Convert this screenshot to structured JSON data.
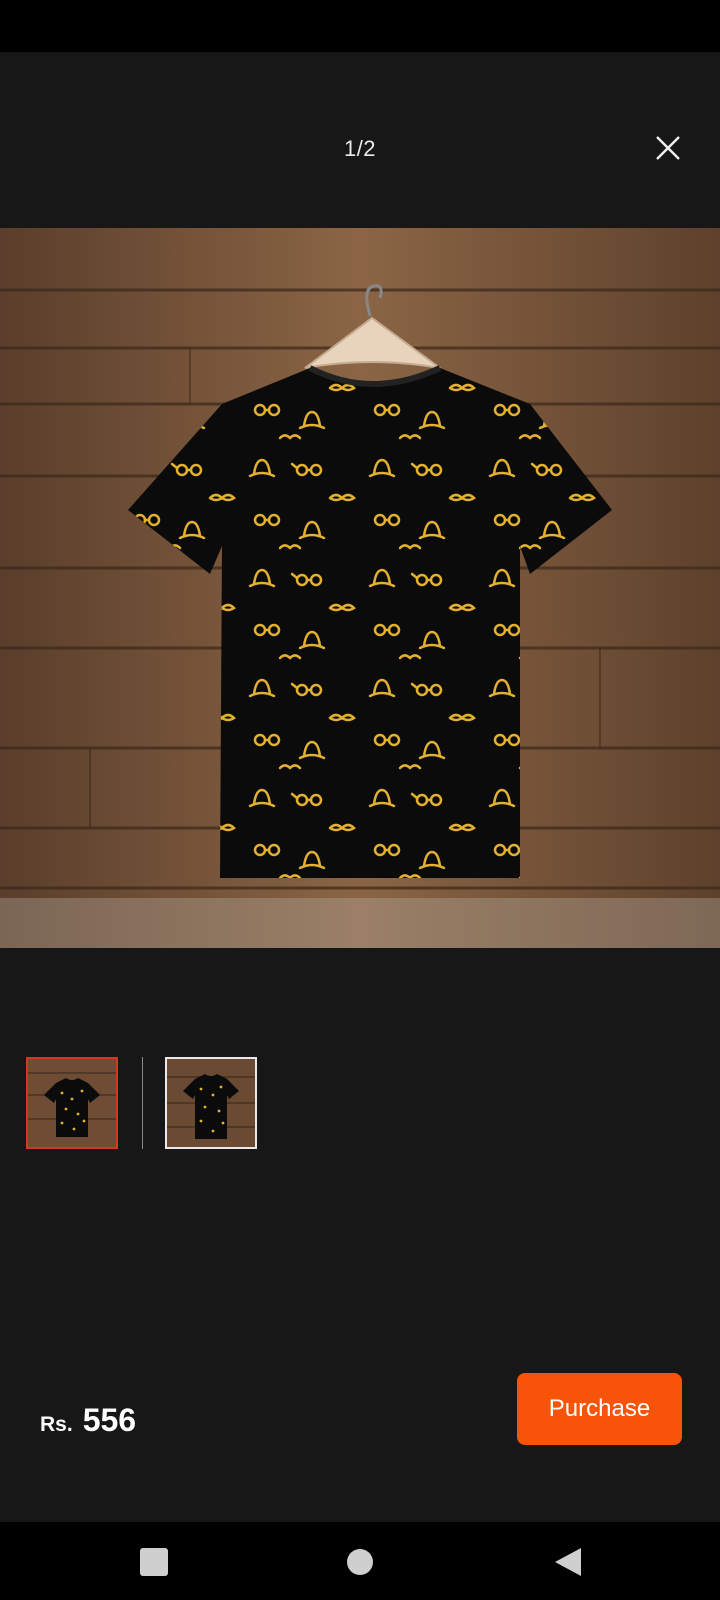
{
  "viewer": {
    "counter": "1/2",
    "close_icon": "close-icon"
  },
  "product_image": {
    "description_icon": "tshirt-icon",
    "pattern_color": "#e3b02f",
    "shirt_color": "#0b0b0b"
  },
  "thumbnails": [
    {
      "selected": true
    },
    {
      "selected": false
    }
  ],
  "price": {
    "currency": "Rs.",
    "amount": "556"
  },
  "actions": {
    "purchase_label": "Purchase"
  },
  "colors": {
    "accent": "#f7540a",
    "background": "#171717",
    "thumb_active_border": "#d9341d"
  },
  "navbar": {
    "recents_icon": "square-icon",
    "home_icon": "circle-icon",
    "back_icon": "triangle-back-icon"
  }
}
